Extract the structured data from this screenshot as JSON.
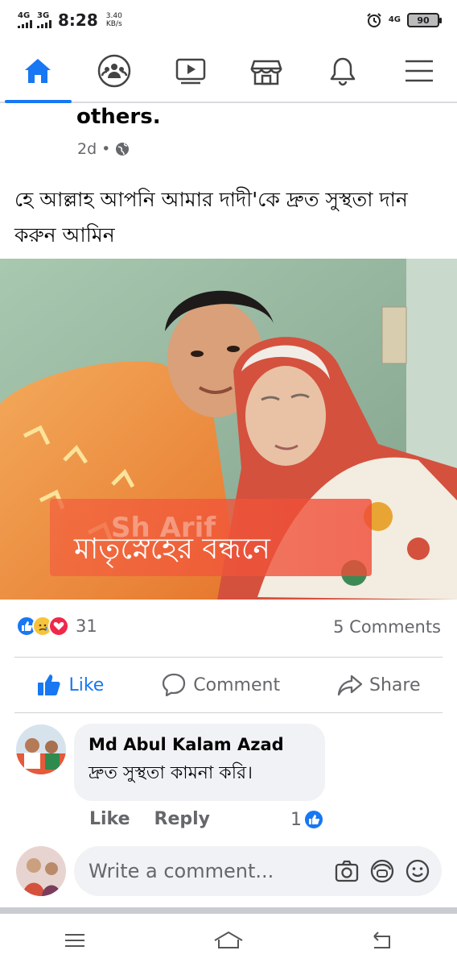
{
  "status_bar": {
    "net1": "4G",
    "net2": "3G",
    "time": "8:28",
    "speed_value": "3.40",
    "speed_unit": "KB/s",
    "net3": "4G",
    "battery": "90"
  },
  "nav": {
    "items": [
      "home-icon",
      "groups-icon",
      "watch-icon",
      "marketplace-icon",
      "notifications-icon",
      "menu-icon"
    ],
    "active": "home-icon",
    "accent": "#1877f2"
  },
  "post": {
    "author_fragment": "others.",
    "time": "2d",
    "separator": "•",
    "text": "হে আল্লাহ আপনি আমার দাদী'কে দ্রুত সুস্থতা দান করুন আমিন",
    "image_caption": "মাতৃস্নেহের বন্ধনে",
    "image_watermark": "Sh Arif"
  },
  "reactions": {
    "count": "31",
    "comments": "5 Comments"
  },
  "actions": {
    "like": "Like",
    "comment": "Comment",
    "share": "Share"
  },
  "comment": {
    "author": "Md Abul Kalam Azad",
    "text": "দ্রুত সুস্থতা কামনা করি।",
    "like_label": "Like",
    "reply_label": "Reply",
    "like_count": "1"
  },
  "composer": {
    "placeholder": "Write a comment..."
  }
}
